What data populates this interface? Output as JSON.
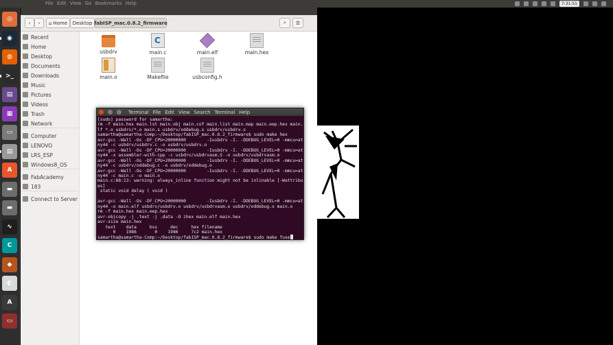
{
  "topbar": {
    "menus": [
      "File",
      "Edit",
      "View",
      "Go",
      "Bookmarks",
      "Help"
    ],
    "clock": "7:31:51"
  },
  "launcher": {
    "items": [
      {
        "name": "ubuntu-dash-icon",
        "color": "#e06e3a",
        "glyph": "◎"
      },
      {
        "name": "steam-icon",
        "color": "#1b2838",
        "glyph": "◉"
      },
      {
        "name": "firefox-icon",
        "color": "#e66000",
        "glyph": "◍"
      },
      {
        "name": "terminal-icon",
        "color": "#2b2b2b",
        "glyph": ">_"
      },
      {
        "name": "app-icon",
        "color": "#6a4a8c",
        "glyph": "▤"
      },
      {
        "name": "app-purple-icon",
        "color": "#8a3ab9",
        "glyph": "▦"
      },
      {
        "name": "drive-icon",
        "color": "#7a7a7a",
        "glyph": "▭"
      },
      {
        "name": "files-icon",
        "color": "#9a9a9a",
        "glyph": "▤"
      },
      {
        "name": "software-center-icon",
        "color": "#e9562a",
        "glyph": "A"
      },
      {
        "name": "drive-2-icon",
        "color": "#6d6d6d",
        "glyph": "▬"
      },
      {
        "name": "drive-3-icon",
        "color": "#6d6d6d",
        "glyph": "▬"
      },
      {
        "name": "system-monitor-icon",
        "color": "#1e1e1e",
        "glyph": "∿"
      },
      {
        "name": "arduino-icon",
        "color": "#00979d",
        "glyph": "C"
      },
      {
        "name": "game-icon",
        "color": "#b5541f",
        "glyph": "◆"
      },
      {
        "name": "app-light-icon",
        "color": "#d9d9d9",
        "glyph": "◐"
      },
      {
        "name": "inkscape-icon",
        "color": "#3a3a3a",
        "glyph": "A"
      },
      {
        "name": "trash-launcher-icon",
        "color": "#8f2f2f",
        "glyph": "▭"
      }
    ]
  },
  "file_manager": {
    "nav": {
      "back": "‹",
      "forward": "›",
      "search_icon": "⌕",
      "menu_icon": "☰"
    },
    "breadcrumb": [
      "Home",
      "Desktop",
      "fabISP_mac.0.8.2_firmware"
    ],
    "sidebar": [
      "Recent",
      "Home",
      "Desktop",
      "Documents",
      "Downloads",
      "Music",
      "Pictures",
      "Videos",
      "Trash",
      "Network",
      "Computer",
      "LENOVO",
      "LRS_ESP",
      "Windows8_OS",
      "FabAcademy",
      "183",
      "Connect to Server"
    ],
    "files": [
      {
        "label": "usbdrv",
        "type": "folder"
      },
      {
        "label": "main.c",
        "type": "c"
      },
      {
        "label": "main.elf",
        "type": "elf"
      },
      {
        "label": "main.hex",
        "type": "doc"
      },
      {
        "label": "main.o",
        "type": "obj"
      },
      {
        "label": "Makefile",
        "type": "doc"
      },
      {
        "label": "usbconfig.h",
        "type": "doc"
      }
    ]
  },
  "terminal": {
    "menus": [
      "Terminal",
      "File",
      "Edit",
      "View",
      "Search",
      "Terminal",
      "Help"
    ],
    "lines": [
      "[sudo] password for samartha:",
      "rm -f main.hex main.lst main.obj main.cof main.list main.map main.eep.hex main.e",
      "lf *.o usbdrv/*.o main.s usbdrv/oddebug.s usbdrv/usbdrv.s",
      "samartha@samartha-Comp:~/Desktop/fabISP_mac.0.8.2_firmware$ sudo make hex",
      "avr-gcc -Wall -Os -DF_CPU=20000000        -Iusbdrv -I. -DDEBUG_LEVEL=0 -mmcu=atti",
      "ny44 -c usbdrv/usbdrv.c -o usbdrv/usbdrv.o",
      "avr-gcc -Wall -Os -DF_CPU=20000000        -Iusbdrv -I. -DDEBUG_LEVEL=0 -mmcu=atti",
      "ny44 -x assembler-with-cpp -c usbdrv/usbdrvasm.S -o usbdrv/usbdrvasm.o",
      "avr-gcc -Wall -Os -DF_CPU=20000000        -Iusbdrv -I. -DDEBUG_LEVEL=0 -mmcu=atti",
      "ny44 -c usbdrv/oddebug.c -o usbdrv/oddebug.o",
      "avr-gcc -Wall -Os -DF_CPU=20000000        -Iusbdrv -I. -DDEBUG_LEVEL=0 -mmcu=atti",
      "ny44 -c main.c -o main.o",
      "main.c:88:13: warning: always_inline function might not be inlinable [-Wattribut",
      "es]",
      " static void delay ( void )",
      "             ^",
      "avr-gcc -Wall -Os -DF_CPU=20000000        -Iusbdrv -I. -DDEBUG_LEVEL=0 -mmcu=atti",
      "ny44 -o main.elf usbdrv/usbdrv.o usbdrv/usbdrvasm.o usbdrv/oddebug.o main.o",
      "rm -f main.hex main.eep.hex",
      "avr-objcopy -j .text -j .data -O ihex main.elf main.hex",
      "avr-size main.hex",
      "   text    data     bss     dec     hex filename",
      "      0    1986       0    1986     7c2 main.hex",
      "samartha@samartha-Comp:~/Desktop/fabISP_mac.0.8.2_firmware$ sudo make fuse"
    ]
  }
}
